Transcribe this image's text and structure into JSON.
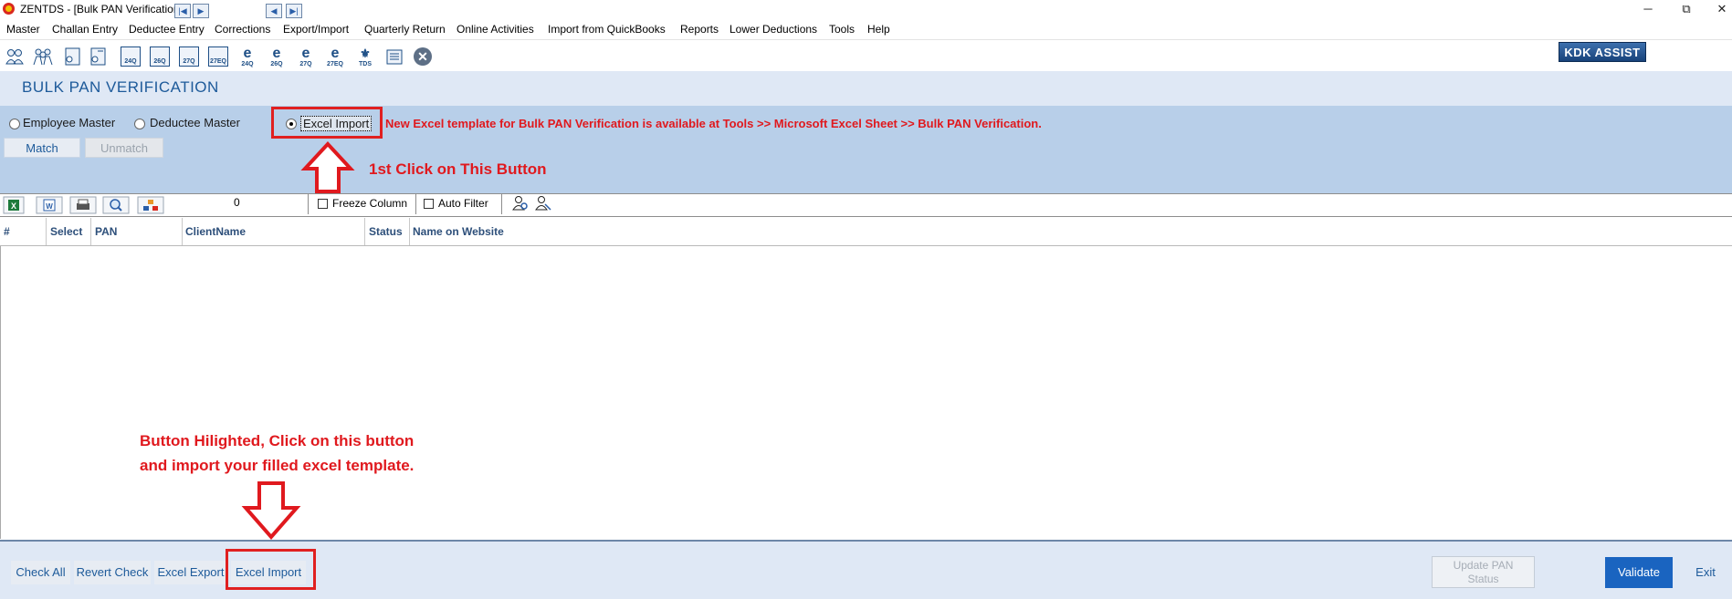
{
  "window": {
    "title": "ZENTDS - [Bulk PAN Verification]",
    "minimize_glyph": "─",
    "restore_glyph": "⧉",
    "close_glyph": "✕"
  },
  "menu": {
    "items": [
      "Master",
      "Challan Entry",
      "Deductee Entry",
      "Corrections",
      "Export/Import",
      "Quarterly Return",
      "Online Activities",
      "Import from QuickBooks",
      "Reports",
      "Lower Deductions",
      "Tools",
      "Help"
    ]
  },
  "toolbar": {
    "form_labels": [
      "24Q",
      "26Q",
      "27Q",
      "27EQ"
    ],
    "e_labels": [
      "24Q",
      "26Q",
      "27Q",
      "27EQ"
    ],
    "tds_label": "TDS",
    "close_glyph": "✕",
    "kdk_assist": "KDK ASSIST"
  },
  "page": {
    "title": "BULK PAN VERIFICATION"
  },
  "options": {
    "employee_master": "Employee Master",
    "deductee_master": "Deductee Master",
    "excel_import": "Excel Import",
    "selected": "excel_import",
    "template_notice": "New Excel template for Bulk PAN Verification is available at Tools >> Microsoft Excel Sheet >> Bulk PAN Verification.",
    "match": "Match",
    "unmatch": "Unmatch"
  },
  "annotations": {
    "first_click": "1st Click on This Button",
    "second_line1": "Button Hilighted, Click on this button",
    "second_line2": "and import your filled excel template.",
    "accent_color": "#e0191e"
  },
  "grid_toolbar": {
    "record_count": "0",
    "freeze_column": "Freeze Column",
    "auto_filter": "Auto Filter"
  },
  "table": {
    "columns": [
      "#",
      "Select",
      "PAN",
      "ClientName",
      "Status",
      "Name on Website"
    ],
    "rows": []
  },
  "footer": {
    "check_all": "Check All",
    "revert_check": "Revert Check",
    "excel_export": "Excel Export",
    "excel_import": "Excel Import",
    "update_pan_status_line1": "Update PAN",
    "update_pan_status_line2": "Status",
    "validate": "Validate",
    "exit": "Exit"
  }
}
